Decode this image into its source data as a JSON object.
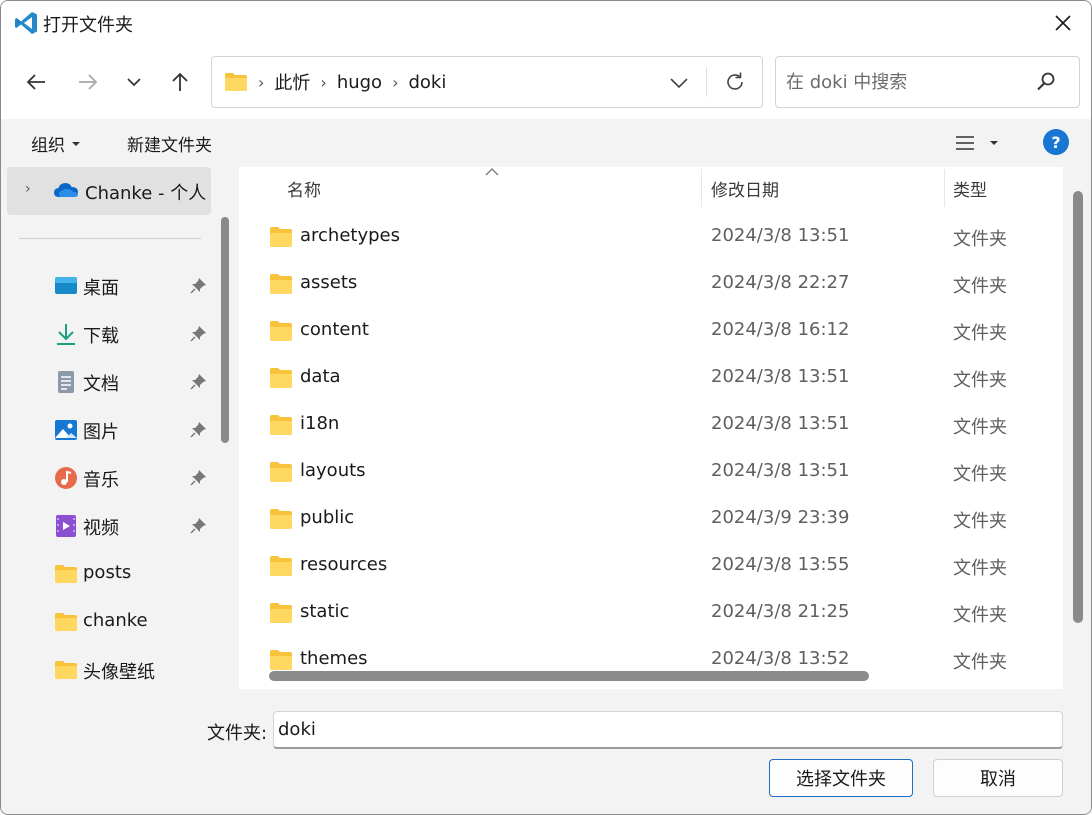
{
  "window": {
    "title": "打开文件夹",
    "accent": "#1976d2"
  },
  "address": {
    "crumbs": [
      "此忻",
      "hugo",
      "doki"
    ]
  },
  "search": {
    "placeholder": "在 doki 中搜索"
  },
  "toolbar": {
    "organize": "组织",
    "new_folder": "新建文件夹",
    "help": "?"
  },
  "nav": {
    "onedrive": "Chanke - 个人",
    "items": [
      {
        "label": "桌面",
        "icon": "desktop-icon",
        "pinned": true
      },
      {
        "label": "下载",
        "icon": "download-icon",
        "pinned": true
      },
      {
        "label": "文档",
        "icon": "document-icon",
        "pinned": true
      },
      {
        "label": "图片",
        "icon": "pictures-icon",
        "pinned": true
      },
      {
        "label": "音乐",
        "icon": "music-icon",
        "pinned": true
      },
      {
        "label": "视频",
        "icon": "video-icon",
        "pinned": true
      },
      {
        "label": "posts",
        "icon": "folder-icon",
        "pinned": false
      },
      {
        "label": "chanke",
        "icon": "folder-icon",
        "pinned": false
      },
      {
        "label": "头像壁纸",
        "icon": "folder-icon",
        "pinned": false
      }
    ]
  },
  "columns": {
    "name": "名称",
    "date": "修改日期",
    "type": "类型"
  },
  "files": [
    {
      "name": "archetypes",
      "date": "2024/3/8 13:51",
      "type": "文件夹"
    },
    {
      "name": "assets",
      "date": "2024/3/8 22:27",
      "type": "文件夹"
    },
    {
      "name": "content",
      "date": "2024/3/8 16:12",
      "type": "文件夹"
    },
    {
      "name": "data",
      "date": "2024/3/8 13:51",
      "type": "文件夹"
    },
    {
      "name": "i18n",
      "date": "2024/3/8 13:51",
      "type": "文件夹"
    },
    {
      "name": "layouts",
      "date": "2024/3/8 13:51",
      "type": "文件夹"
    },
    {
      "name": "public",
      "date": "2024/3/9 23:39",
      "type": "文件夹"
    },
    {
      "name": "resources",
      "date": "2024/3/8 13:55",
      "type": "文件夹"
    },
    {
      "name": "static",
      "date": "2024/3/8 21:25",
      "type": "文件夹"
    },
    {
      "name": "themes",
      "date": "2024/3/8 13:52",
      "type": "文件夹"
    }
  ],
  "bottom": {
    "folder_label": "文件夹:",
    "folder_value": "doki",
    "select_button": "选择文件夹",
    "cancel_button": "取消"
  }
}
